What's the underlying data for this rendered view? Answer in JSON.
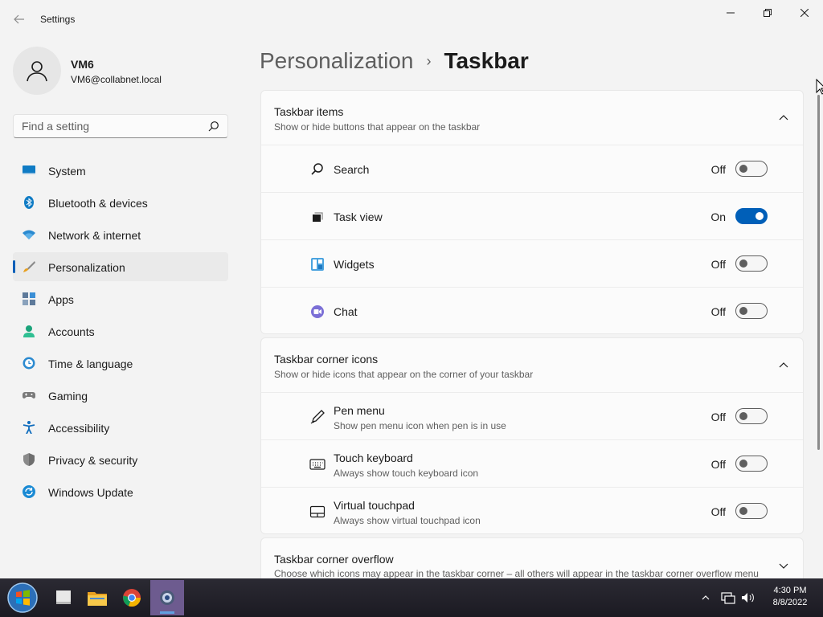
{
  "window": {
    "title": "Settings",
    "controls": [
      "minimize",
      "maximize",
      "close"
    ]
  },
  "profile": {
    "name": "VM6",
    "email": "VM6@collabnet.local"
  },
  "search": {
    "placeholder": "Find a setting"
  },
  "sidebar": {
    "items": [
      {
        "label": "System",
        "icon": "monitor-icon",
        "selected": false
      },
      {
        "label": "Bluetooth & devices",
        "icon": "bluetooth-icon",
        "selected": false
      },
      {
        "label": "Network & internet",
        "icon": "wifi-icon",
        "selected": false
      },
      {
        "label": "Personalization",
        "icon": "brush-icon",
        "selected": true
      },
      {
        "label": "Apps",
        "icon": "apps-icon",
        "selected": false
      },
      {
        "label": "Accounts",
        "icon": "person-icon",
        "selected": false
      },
      {
        "label": "Time & language",
        "icon": "clock-globe-icon",
        "selected": false
      },
      {
        "label": "Gaming",
        "icon": "gamepad-icon",
        "selected": false
      },
      {
        "label": "Accessibility",
        "icon": "accessibility-icon",
        "selected": false
      },
      {
        "label": "Privacy & security",
        "icon": "shield-icon",
        "selected": false
      },
      {
        "label": "Windows Update",
        "icon": "update-icon",
        "selected": false
      }
    ]
  },
  "breadcrumb": {
    "parent": "Personalization",
    "separator": "›",
    "current": "Taskbar"
  },
  "sections": {
    "taskbar_items": {
      "title": "Taskbar items",
      "subtitle": "Show or hide buttons that appear on the taskbar",
      "expanded": true,
      "rows": [
        {
          "label": "Search",
          "state": "Off",
          "on": false,
          "icon": "search-icon"
        },
        {
          "label": "Task view",
          "state": "On",
          "on": true,
          "icon": "task-view-icon"
        },
        {
          "label": "Widgets",
          "state": "Off",
          "on": false,
          "icon": "widgets-icon"
        },
        {
          "label": "Chat",
          "state": "Off",
          "on": false,
          "icon": "chat-icon"
        }
      ]
    },
    "corner_icons": {
      "title": "Taskbar corner icons",
      "subtitle": "Show or hide icons that appear on the corner of your taskbar",
      "expanded": true,
      "rows": [
        {
          "label": "Pen menu",
          "sub": "Show pen menu icon when pen is in use",
          "state": "Off",
          "on": false,
          "icon": "pen-icon"
        },
        {
          "label": "Touch keyboard",
          "sub": "Always show touch keyboard icon",
          "state": "Off",
          "on": false,
          "icon": "keyboard-icon"
        },
        {
          "label": "Virtual touchpad",
          "sub": "Always show virtual touchpad icon",
          "state": "Off",
          "on": false,
          "icon": "touchpad-icon"
        }
      ]
    },
    "corner_overflow": {
      "title": "Taskbar corner overflow",
      "subtitle": "Choose which icons may appear in the taskbar corner – all others will appear in the taskbar corner overflow menu",
      "expanded": false
    }
  },
  "taskbar": {
    "apps": [
      "start-orb-icon",
      "desktop-icon",
      "file-explorer-icon",
      "chrome-icon",
      "settings-app-icon"
    ],
    "tray": [
      "chevron-up-icon",
      "network-icon",
      "volume-icon"
    ],
    "clock": {
      "time": "4:30 PM",
      "date": "8/8/2022"
    }
  },
  "colors": {
    "accent": "#005fb8",
    "background": "#f3f3f3",
    "card": "#fbfbfb",
    "taskbar": "#1b1a22"
  }
}
